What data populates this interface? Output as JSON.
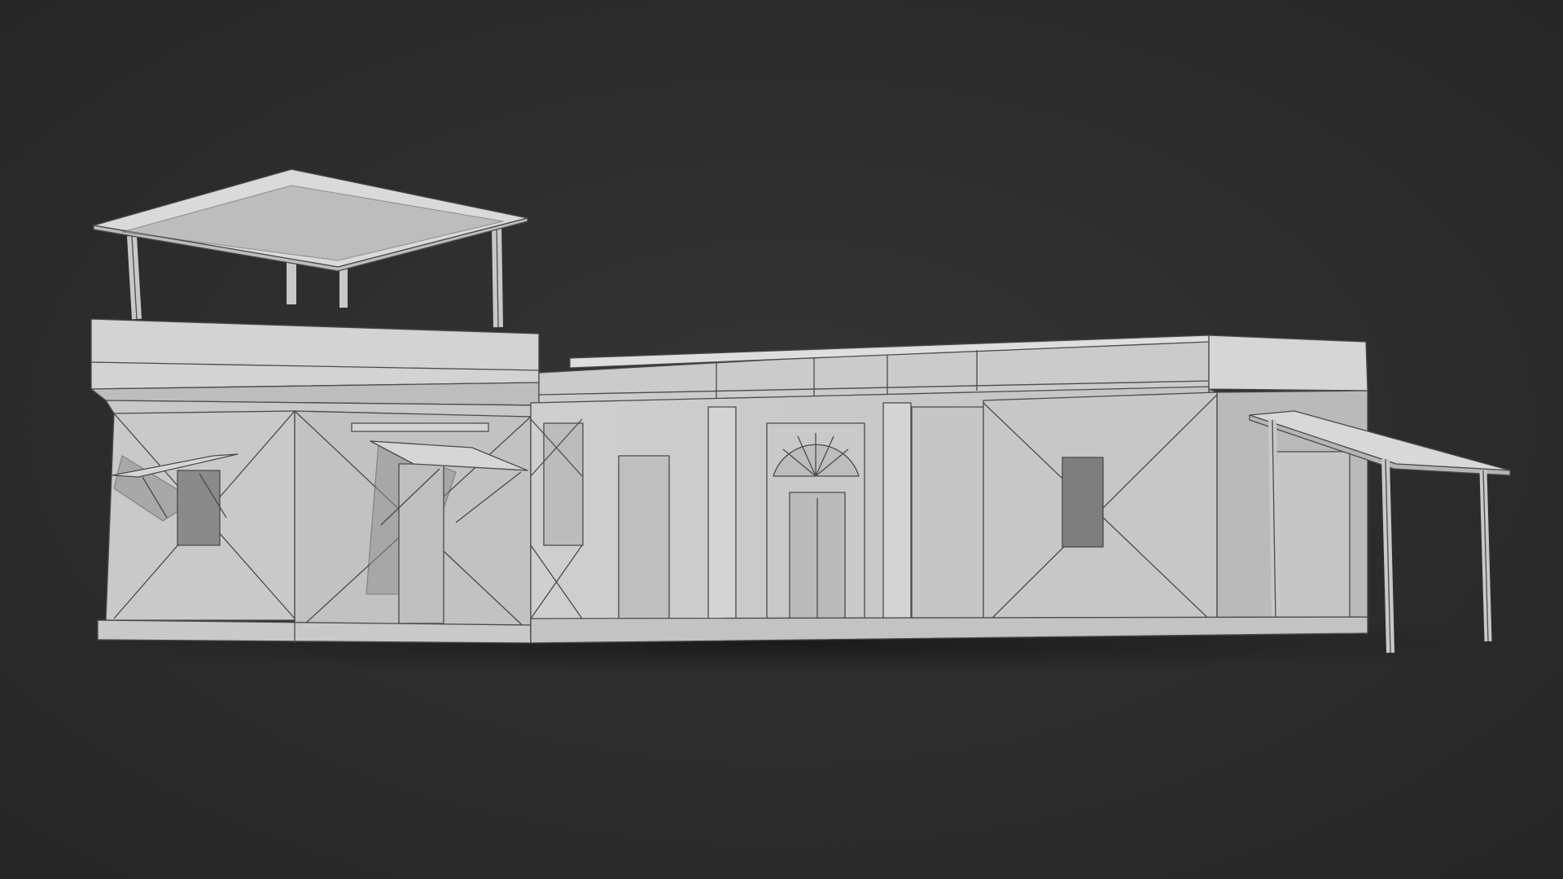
{
  "scene": {
    "subject": "clay-render-building",
    "colors": {
      "background": "#2a2a2a",
      "background_center": "#333333",
      "wall_lit": "#d9d9d9",
      "wall_front": "#c6c6c6",
      "wall_shadow": "#9e9e9e",
      "edge": "#4a4a4a",
      "opening": "#7f7f7f",
      "ground_shadow": "#1c1c1c"
    }
  }
}
